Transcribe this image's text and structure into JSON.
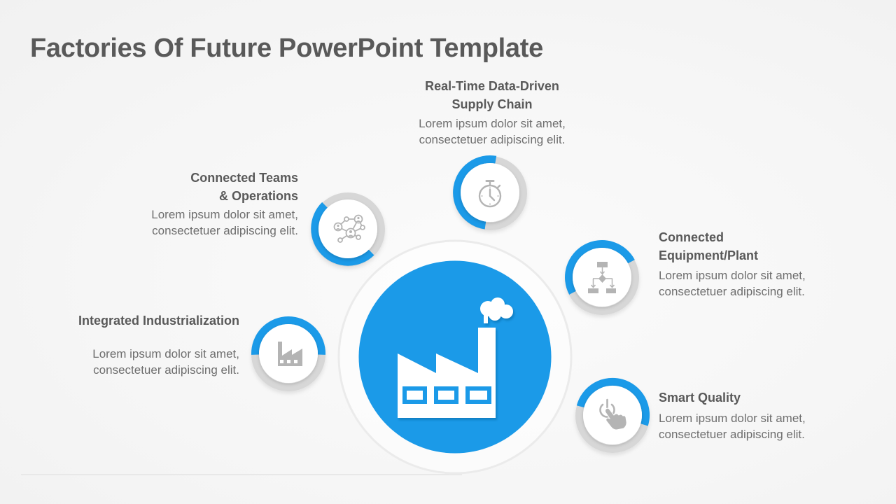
{
  "title": "Factories Of Future PowerPoint Template",
  "colors": {
    "accent": "#1b9ae8",
    "track": "#d7d7d7",
    "icon": "#b4b4b4",
    "heading": "#595959",
    "body": "#6e6e6e"
  },
  "center": {
    "icon": "factory-icon"
  },
  "items": [
    {
      "id": "supply-chain",
      "icon": "stopwatch-icon",
      "heading": [
        "Real-Time Data-Driven",
        "Supply Chain"
      ],
      "body": [
        "Lorem ipsum dolor sit amet,",
        "consectetuer adipiscing elit."
      ]
    },
    {
      "id": "connected-teams",
      "icon": "network-icon",
      "heading": [
        "Connected Teams",
        "& Operations"
      ],
      "body": [
        "Lorem ipsum dolor sit amet,",
        "consectetuer adipiscing elit."
      ]
    },
    {
      "id": "connected-equipment",
      "icon": "flowchart-icon",
      "heading": [
        "Connected",
        "Equipment/Plant"
      ],
      "body": [
        "Lorem ipsum dolor sit amet,",
        "consectetuer adipiscing elit."
      ]
    },
    {
      "id": "integrated-industrialization",
      "icon": "factory-icon",
      "heading": [
        "Integrated Industrialization"
      ],
      "body": [
        "Lorem ipsum dolor sit amet,",
        "consectetuer adipiscing elit."
      ]
    },
    {
      "id": "smart-quality",
      "icon": "power-touch-icon",
      "heading": [
        "Smart Quality"
      ],
      "body": [
        "Lorem ipsum dolor sit amet,",
        "consectetuer adipiscing elit."
      ]
    }
  ]
}
